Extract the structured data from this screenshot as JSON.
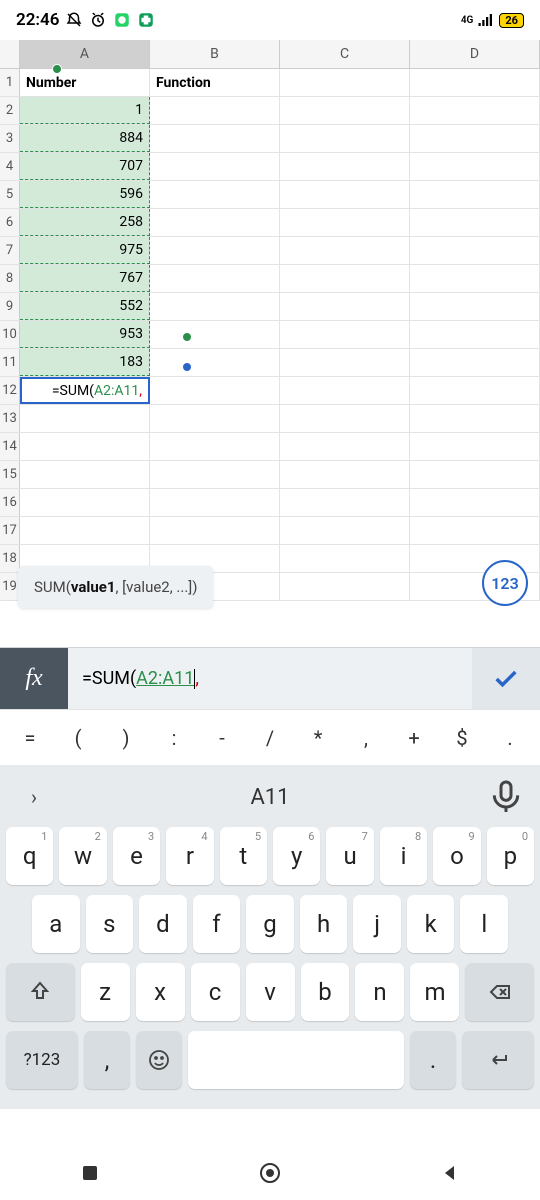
{
  "status": {
    "time": "22:46",
    "network": "4G",
    "battery": "26"
  },
  "sheet": {
    "columns": [
      "A",
      "B",
      "C",
      "D"
    ],
    "rows": [
      {
        "n": "1",
        "A": "Number",
        "B": "Function",
        "C": "",
        "D": ""
      },
      {
        "n": "2",
        "A": "1",
        "B": "",
        "C": "",
        "D": ""
      },
      {
        "n": "3",
        "A": "884",
        "B": "",
        "C": "",
        "D": ""
      },
      {
        "n": "4",
        "A": "707",
        "B": "",
        "C": "",
        "D": ""
      },
      {
        "n": "5",
        "A": "596",
        "B": "",
        "C": "",
        "D": ""
      },
      {
        "n": "6",
        "A": "258",
        "B": "",
        "C": "",
        "D": ""
      },
      {
        "n": "7",
        "A": "975",
        "B": "",
        "C": "",
        "D": ""
      },
      {
        "n": "8",
        "A": "767",
        "B": "",
        "C": "",
        "D": ""
      },
      {
        "n": "9",
        "A": "552",
        "B": "",
        "C": "",
        "D": ""
      },
      {
        "n": "10",
        "A": "953",
        "B": "",
        "C": "",
        "D": ""
      },
      {
        "n": "11",
        "A": "183",
        "B": "",
        "C": "",
        "D": ""
      },
      {
        "n": "12",
        "A": "",
        "B": "",
        "C": "",
        "D": ""
      },
      {
        "n": "13",
        "A": "",
        "B": "",
        "C": "",
        "D": ""
      },
      {
        "n": "14",
        "A": "",
        "B": "",
        "C": "",
        "D": ""
      },
      {
        "n": "15",
        "A": "",
        "B": "",
        "C": "",
        "D": ""
      },
      {
        "n": "16",
        "A": "",
        "B": "",
        "C": "",
        "D": ""
      },
      {
        "n": "17",
        "A": "",
        "B": "",
        "C": "",
        "D": ""
      },
      {
        "n": "18",
        "A": "",
        "B": "",
        "C": "",
        "D": ""
      },
      {
        "n": "19",
        "A": "",
        "B": "",
        "C": "",
        "D": ""
      }
    ],
    "active_formula_prefix": "=SUM(",
    "active_formula_ref": "A2:A11",
    "active_formula_suffix": ","
  },
  "tooltip": {
    "fn": "SUM",
    "arg_bold": "value1",
    "rest": ", [value2, ...])"
  },
  "pill": "123",
  "fx": {
    "prefix": "=SUM(",
    "ref": "A2:A11",
    "suffix": ","
  },
  "symbols": [
    "=",
    "(",
    ")",
    ":",
    "-",
    "/",
    "*",
    ",",
    "+",
    "$",
    "."
  ],
  "keyboard": {
    "suggestion": "A11",
    "row1": [
      {
        "c": "q",
        "n": "1"
      },
      {
        "c": "w",
        "n": "2"
      },
      {
        "c": "e",
        "n": "3"
      },
      {
        "c": "r",
        "n": "4"
      },
      {
        "c": "t",
        "n": "5"
      },
      {
        "c": "y",
        "n": "6"
      },
      {
        "c": "u",
        "n": "7"
      },
      {
        "c": "i",
        "n": "8"
      },
      {
        "c": "o",
        "n": "9"
      },
      {
        "c": "p",
        "n": "0"
      }
    ],
    "row2": [
      {
        "c": "a"
      },
      {
        "c": "s"
      },
      {
        "c": "d"
      },
      {
        "c": "f"
      },
      {
        "c": "g"
      },
      {
        "c": "h"
      },
      {
        "c": "j"
      },
      {
        "c": "k"
      },
      {
        "c": "l"
      }
    ],
    "row3": [
      {
        "c": "z"
      },
      {
        "c": "x"
      },
      {
        "c": "c"
      },
      {
        "c": "v"
      },
      {
        "c": "b"
      },
      {
        "c": "n"
      },
      {
        "c": "m"
      }
    ],
    "mode_key": "?123",
    "comma": ",",
    "period": "."
  }
}
